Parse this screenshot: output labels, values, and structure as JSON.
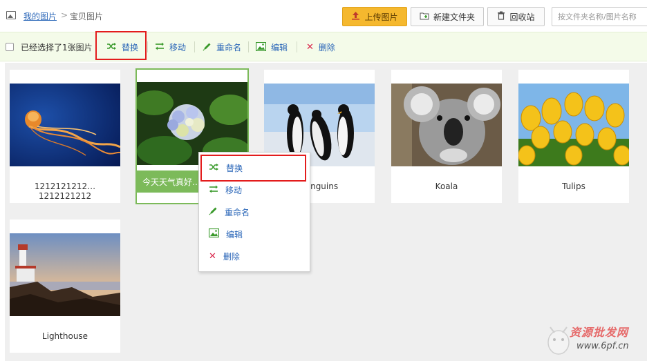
{
  "breadcrumb": {
    "root": "我的图片",
    "separator": ">",
    "current": "宝贝图片"
  },
  "header": {
    "upload_label": "上传图片",
    "new_folder_label": "新建文件夹",
    "recycle_label": "回收站",
    "search_placeholder": "按文件夹名称/图片名称"
  },
  "toolbar": {
    "selection_text": "已经选择了1张图片",
    "replace": "替换",
    "move": "移动",
    "rename": "重命名",
    "edit": "编辑",
    "delete": "删除"
  },
  "images": [
    {
      "label": "1212121212…1212121212",
      "subject": "jellyfish"
    },
    {
      "label": "今天天气真好…",
      "subject": "hydrangea",
      "selected": true
    },
    {
      "label": "Penguins",
      "subject": "penguins"
    },
    {
      "label": "Koala",
      "subject": "koala"
    },
    {
      "label": "Tulips",
      "subject": "tulips"
    },
    {
      "label": "Lighthouse",
      "subject": "lighthouse"
    }
  ],
  "context_menu": {
    "items": [
      "替换",
      "移动",
      "重命名",
      "编辑",
      "删除"
    ]
  },
  "watermark": {
    "text": "资源批发网",
    "url": "www.6pf.cn"
  },
  "colors": {
    "accent_green": "#7cba5a",
    "link_blue": "#2a66b8",
    "upload_yellow": "#f5b82e",
    "highlight_red": "#e31c1c"
  }
}
